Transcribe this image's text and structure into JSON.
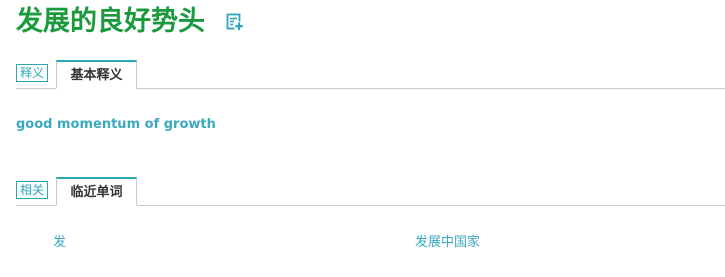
{
  "header": {
    "title": "发展的良好势头"
  },
  "sections": [
    {
      "tag": "释义",
      "tab": "基本释义",
      "content": "good momentum of growth"
    },
    {
      "tag": "相关",
      "tab": "临近单词",
      "items": [
        "发",
        "发展中国家"
      ]
    }
  ],
  "colors": {
    "title": "#1a9a3c",
    "accent": "#2aa6b9",
    "link": "#3aa9c2"
  },
  "icons": {
    "add_wordbook": "add-to-wordbook-icon"
  }
}
